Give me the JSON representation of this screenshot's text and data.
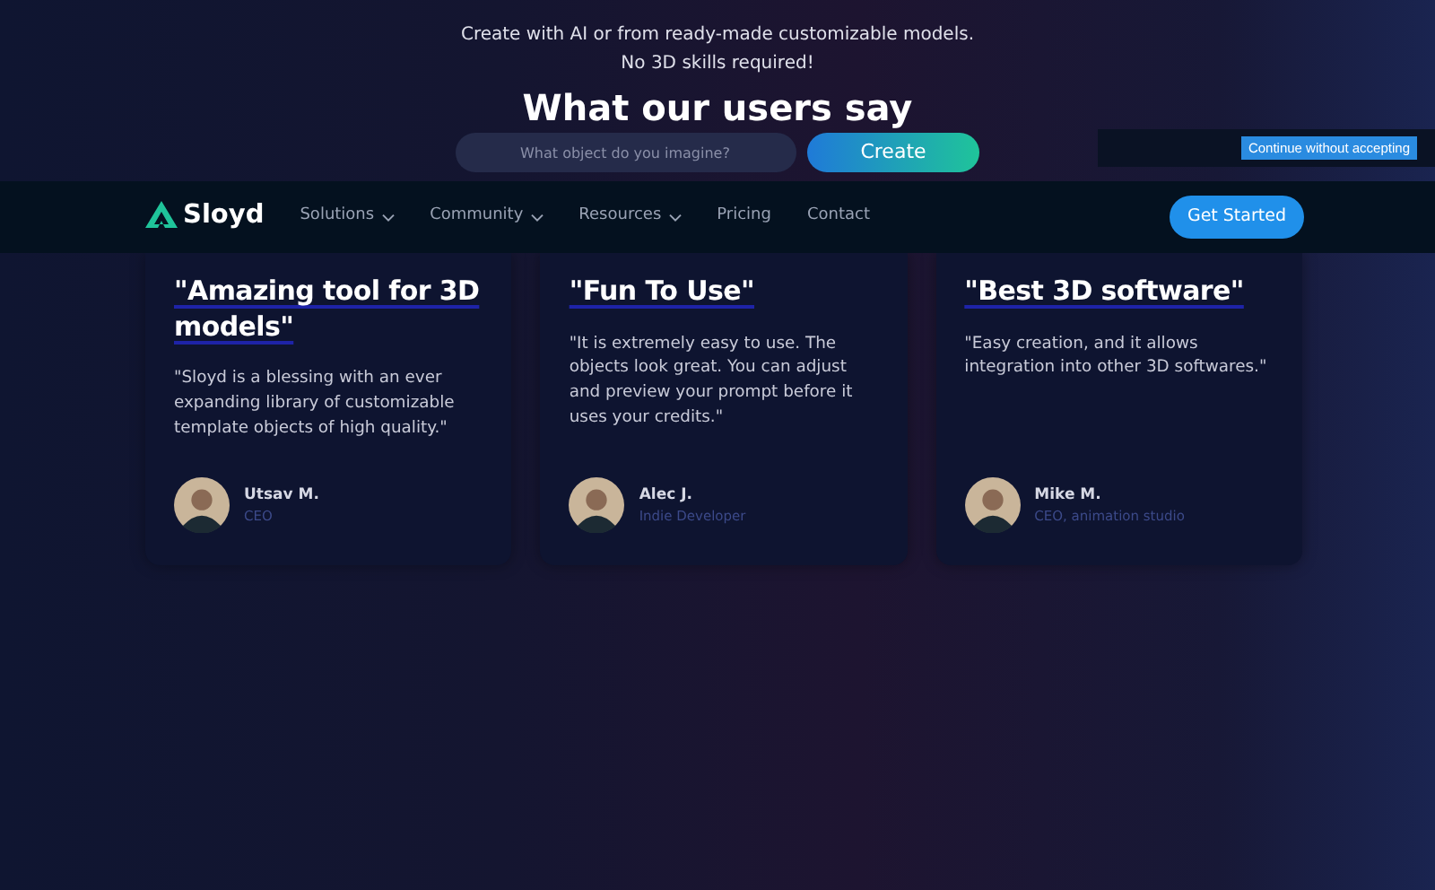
{
  "hero": {
    "subtitle": "Create with AI or from ready-made customizable models. No 3D skills required!",
    "search": {
      "placeholder": "What object do you imagine?"
    },
    "create_button": "Create"
  },
  "section_title": "What our users say",
  "cookie_banner": {
    "button": "Continue without accepting"
  },
  "navbar": {
    "logo": "Sloyd",
    "items": [
      {
        "label": "Solutions",
        "dropdown": true
      },
      {
        "label": "Community",
        "dropdown": true
      },
      {
        "label": "Resources",
        "dropdown": true
      },
      {
        "label": "Pricing",
        "dropdown": false
      },
      {
        "label": "Contact",
        "dropdown": false
      }
    ],
    "cta": "Get Started"
  },
  "testimonials": [
    {
      "title": "\"Amazing tool for 3D models\"",
      "quote": "\"Sloyd is a blessing with an ever expanding library of customizable template objects of high quality.\"",
      "name": "Utsav M.",
      "role": "CEO"
    },
    {
      "title": "\"Fun To Use\"",
      "quote": "\"It is extremely easy to use. The objects look great. You can adjust and preview your prompt before it uses your credits.\"",
      "name": "Alec J.",
      "role": "Indie Developer"
    },
    {
      "title": "\"Best 3D software\"",
      "quote": "\"Easy creation, and it allows integration into other 3D softwares.\"",
      "name": "Mike M.",
      "role": "CEO, animation studio"
    }
  ]
}
